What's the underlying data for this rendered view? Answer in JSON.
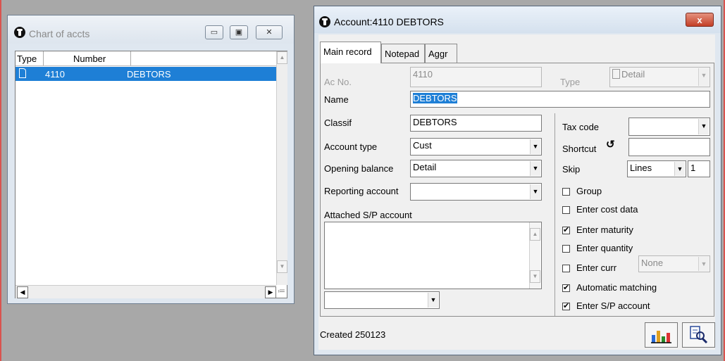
{
  "left_window": {
    "title": "Chart of accts",
    "columns": [
      "Type",
      "Number",
      ""
    ],
    "rows": [
      {
        "number": "4110",
        "name": "DEBTORS"
      }
    ]
  },
  "right_window": {
    "title": "Account:4110 DEBTORS",
    "close_label": "x",
    "tabs": [
      "Main record",
      "Notepad",
      "Aggr"
    ],
    "fields": {
      "ac_no_label": "Ac No.",
      "ac_no_value": "4110",
      "type_label": "Type",
      "type_value": "Detail",
      "name_label": "Name",
      "name_value": "DEBTORS",
      "classif_label": "Classif",
      "classif_value": "DEBTORS",
      "account_type_label": "Account type",
      "account_type_value": "Cust",
      "opening_balance_label": "Opening balance",
      "opening_balance_value": "Detail",
      "reporting_account_label": "Reporting account",
      "reporting_account_value": "",
      "attached_sp_label": "Attached S/P account",
      "attached_sp_value": "",
      "tax_code_label": "Tax code",
      "tax_code_value": "",
      "shortcut_label": "Shortcut",
      "shortcut_value": "",
      "skip_label": "Skip",
      "skip_unit": "Lines",
      "skip_value": "1",
      "curr_value": "None"
    },
    "checkboxes": [
      {
        "label": "Group",
        "checked": false
      },
      {
        "label": "Enter cost data",
        "checked": false
      },
      {
        "label": "Enter maturity",
        "checked": true
      },
      {
        "label": "Enter quantity",
        "checked": false
      },
      {
        "label": "Enter curr",
        "checked": false
      },
      {
        "label": "Automatic matching",
        "checked": true
      },
      {
        "label": "Enter S/P account",
        "checked": true
      }
    ],
    "status_text": "Created 250123"
  }
}
